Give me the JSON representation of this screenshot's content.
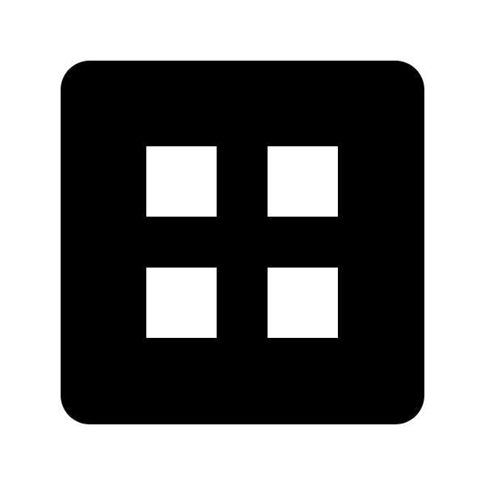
{
  "icon": {
    "name": "grid-icon",
    "foreground": "#000000",
    "background": "#ffffff",
    "cells": [
      {
        "row": 0,
        "col": 0
      },
      {
        "row": 0,
        "col": 1
      },
      {
        "row": 1,
        "col": 0
      },
      {
        "row": 1,
        "col": 1
      }
    ]
  }
}
